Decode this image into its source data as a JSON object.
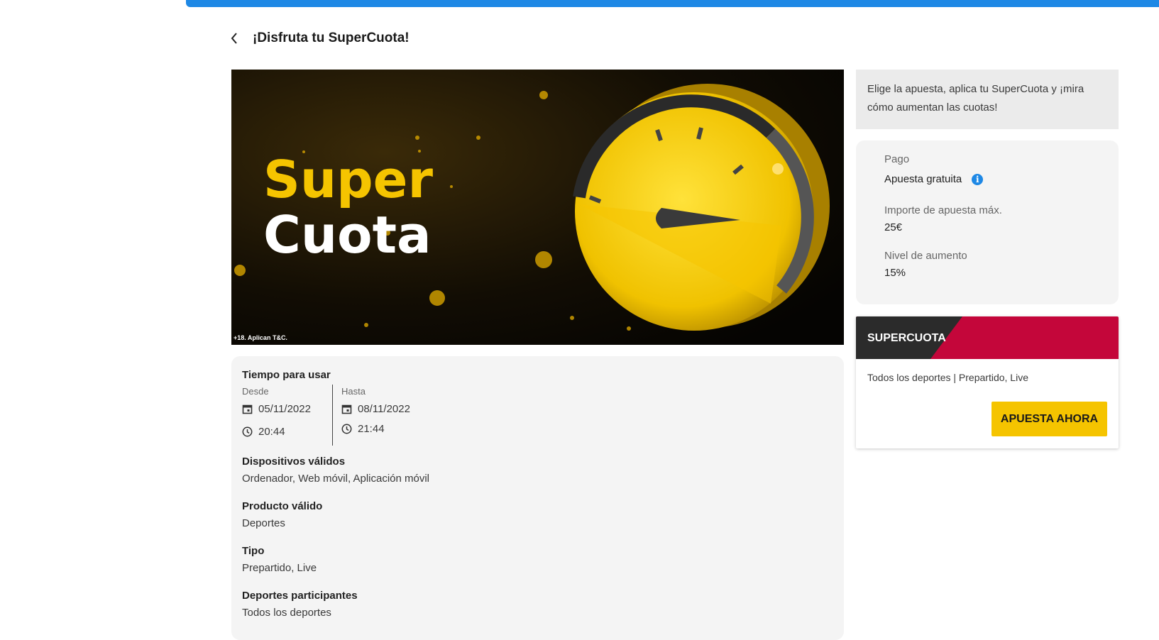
{
  "header": {
    "title": "¡Disfruta tu SuperCuota!",
    "back_icon": "chevron-left-icon"
  },
  "banner": {
    "line1": "Super",
    "line2": "Cuota",
    "legal": "+18. Aplican T&C."
  },
  "details": {
    "time_title": "Tiempo para usar",
    "from_label": "Desde",
    "from_date": "05/11/2022",
    "from_time": "20:44",
    "to_label": "Hasta",
    "to_date": "08/11/2022",
    "to_time": "21:44",
    "devices_title": "Dispositivos válidos",
    "devices_value": "Ordenador, Web móvil, Aplicación móvil",
    "product_title": "Producto válido",
    "product_value": "Deportes",
    "type_title": "Tipo",
    "type_value": "Prepartido, Live",
    "sports_title": "Deportes participantes",
    "sports_value": "Todos los deportes"
  },
  "sidebar": {
    "description": "Elige la apuesta, aplica tu SuperCuota y ¡mira cómo aumentan las cuotas!",
    "payment_label": "Pago",
    "payment_value": "Apuesta gratuita",
    "max_label": "Importe de apuesta máx.",
    "max_value": "25€",
    "boost_label": "Nivel de aumento",
    "boost_value": "15%"
  },
  "promo": {
    "badge": "SUPERCUOTA",
    "subtitle": "Todos los deportes | Prepartido, Live",
    "cta": "APUESTA AHORA"
  },
  "colors": {
    "accent_blue": "#1e88e5",
    "brand_yellow": "#f5c400",
    "brand_red": "#c4063a",
    "panel_gray": "#f4f4f4"
  }
}
